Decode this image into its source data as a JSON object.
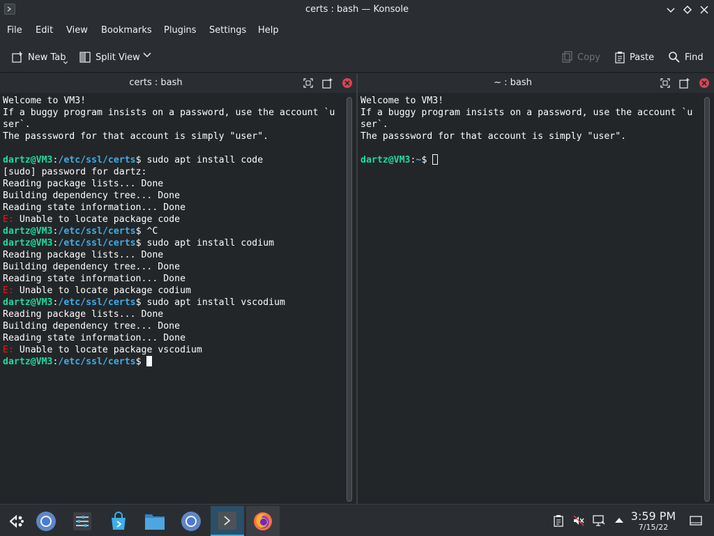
{
  "window": {
    "title": "certs : bash — Konsole"
  },
  "menu": {
    "file": "File",
    "edit": "Edit",
    "view": "View",
    "bookmarks": "Bookmarks",
    "plugins": "Plugins",
    "settings": "Settings",
    "help": "Help"
  },
  "toolbar": {
    "new_tab": "New Tab",
    "split_view": "Split View",
    "copy": "Copy",
    "paste": "Paste",
    "find": "Find"
  },
  "left_pane": {
    "title": "certs : bash",
    "lines": [
      {
        "segments": [
          {
            "t": "Welcome to VM3!",
            "c": ""
          }
        ]
      },
      {
        "segments": [
          {
            "t": "If a buggy program insists on a password, use the account `u",
            "c": ""
          }
        ]
      },
      {
        "segments": [
          {
            "t": "ser`.",
            "c": ""
          }
        ]
      },
      {
        "segments": [
          {
            "t": "The passsword for that account is simply \"user\".",
            "c": ""
          }
        ]
      },
      {
        "segments": [
          {
            "t": "",
            "c": ""
          }
        ]
      },
      {
        "segments": [
          {
            "t": "dartz@VM3",
            "c": "prompt-user"
          },
          {
            "t": ":",
            "c": ""
          },
          {
            "t": "/etc/ssl/certs",
            "c": "prompt-path"
          },
          {
            "t": "$ sudo apt install code",
            "c": ""
          }
        ]
      },
      {
        "segments": [
          {
            "t": "[sudo] password for dartz:",
            "c": ""
          }
        ]
      },
      {
        "segments": [
          {
            "t": "Reading package lists... Done",
            "c": ""
          }
        ]
      },
      {
        "segments": [
          {
            "t": "Building dependency tree... Done",
            "c": ""
          }
        ]
      },
      {
        "segments": [
          {
            "t": "Reading state information... Done",
            "c": ""
          }
        ]
      },
      {
        "segments": [
          {
            "t": "E:",
            "c": "err"
          },
          {
            "t": " Unable to locate package code",
            "c": ""
          }
        ]
      },
      {
        "segments": [
          {
            "t": "dartz@VM3",
            "c": "prompt-user"
          },
          {
            "t": ":",
            "c": ""
          },
          {
            "t": "/etc/ssl/certs",
            "c": "prompt-path"
          },
          {
            "t": "$ ^C",
            "c": ""
          }
        ]
      },
      {
        "segments": [
          {
            "t": "dartz@VM3",
            "c": "prompt-user"
          },
          {
            "t": ":",
            "c": ""
          },
          {
            "t": "/etc/ssl/certs",
            "c": "prompt-path"
          },
          {
            "t": "$ sudo apt install codium",
            "c": ""
          }
        ]
      },
      {
        "segments": [
          {
            "t": "Reading package lists... Done",
            "c": ""
          }
        ]
      },
      {
        "segments": [
          {
            "t": "Building dependency tree... Done",
            "c": ""
          }
        ]
      },
      {
        "segments": [
          {
            "t": "Reading state information... Done",
            "c": ""
          }
        ]
      },
      {
        "segments": [
          {
            "t": "E:",
            "c": "err"
          },
          {
            "t": " Unable to locate package codium",
            "c": ""
          }
        ]
      },
      {
        "segments": [
          {
            "t": "dartz@VM3",
            "c": "prompt-user"
          },
          {
            "t": ":",
            "c": ""
          },
          {
            "t": "/etc/ssl/certs",
            "c": "prompt-path"
          },
          {
            "t": "$ sudo apt install vscodium",
            "c": ""
          }
        ]
      },
      {
        "segments": [
          {
            "t": "Reading package lists... Done",
            "c": ""
          }
        ]
      },
      {
        "segments": [
          {
            "t": "Building dependency tree... Done",
            "c": ""
          }
        ]
      },
      {
        "segments": [
          {
            "t": "Reading state information... Done",
            "c": ""
          }
        ]
      },
      {
        "segments": [
          {
            "t": "E:",
            "c": "err"
          },
          {
            "t": " Unable to locate package vscodium",
            "c": ""
          }
        ]
      },
      {
        "segments": [
          {
            "t": "dartz@VM3",
            "c": "prompt-user"
          },
          {
            "t": ":",
            "c": ""
          },
          {
            "t": "/etc/ssl/certs",
            "c": "prompt-path"
          },
          {
            "t": "$ ",
            "c": ""
          }
        ],
        "cursor": "block"
      }
    ]
  },
  "right_pane": {
    "title": "~ : bash",
    "lines": [
      {
        "segments": [
          {
            "t": "Welcome to VM3!",
            "c": ""
          }
        ]
      },
      {
        "segments": [
          {
            "t": "If a buggy program insists on a password, use the account `u",
            "c": ""
          }
        ]
      },
      {
        "segments": [
          {
            "t": "ser`.",
            "c": ""
          }
        ]
      },
      {
        "segments": [
          {
            "t": "The passsword for that account is simply \"user\".",
            "c": ""
          }
        ]
      },
      {
        "segments": [
          {
            "t": "",
            "c": ""
          }
        ]
      },
      {
        "segments": [
          {
            "t": "dartz@VM3",
            "c": "prompt-user"
          },
          {
            "t": ":",
            "c": ""
          },
          {
            "t": "~",
            "c": "prompt-path"
          },
          {
            "t": "$ ",
            "c": ""
          }
        ],
        "cursor": "hollow"
      }
    ]
  },
  "taskbar": {
    "apps": [
      "application-launcher-icon",
      "chromium-icon",
      "settings-sliders-icon",
      "discover-store-icon",
      "file-manager-icon",
      "chromium-icon",
      "konsole-icon",
      "firefox-icon"
    ],
    "time": "3:59 PM",
    "date": "7/15/22"
  },
  "colors": {
    "prompt_user": "#1cdc9a",
    "prompt_path": "#3daee9",
    "error": "#ed1515",
    "close": "#da4453",
    "accent": "#3daee9"
  }
}
